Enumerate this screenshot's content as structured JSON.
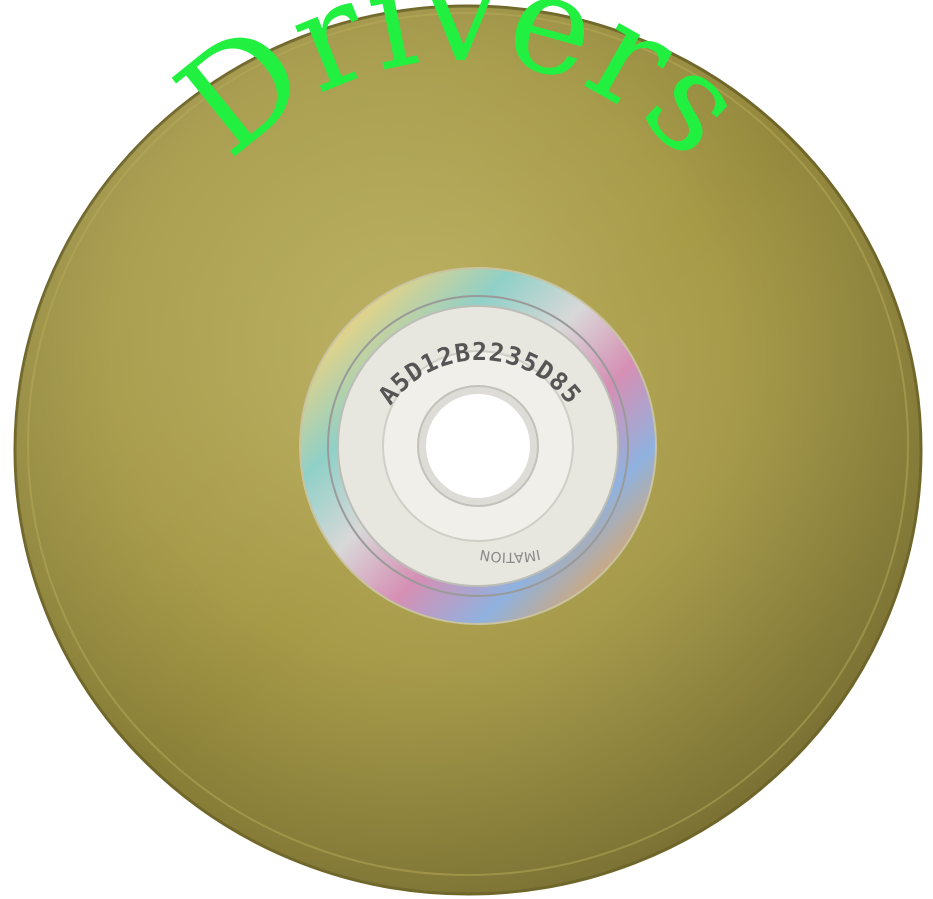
{
  "disc": {
    "label_text": "Drivers",
    "serial_number": "A5D12B2235D85",
    "hub_brand": "IMATION",
    "colors": {
      "background": "#ffffff",
      "disc_gold": "#a69a47",
      "disc_gold_dark": "#7d7330",
      "disc_gold_light": "#bdb263",
      "label_text": "#22f040",
      "hub_plastic": "#e7e6df",
      "hole": "#ffffff"
    }
  }
}
